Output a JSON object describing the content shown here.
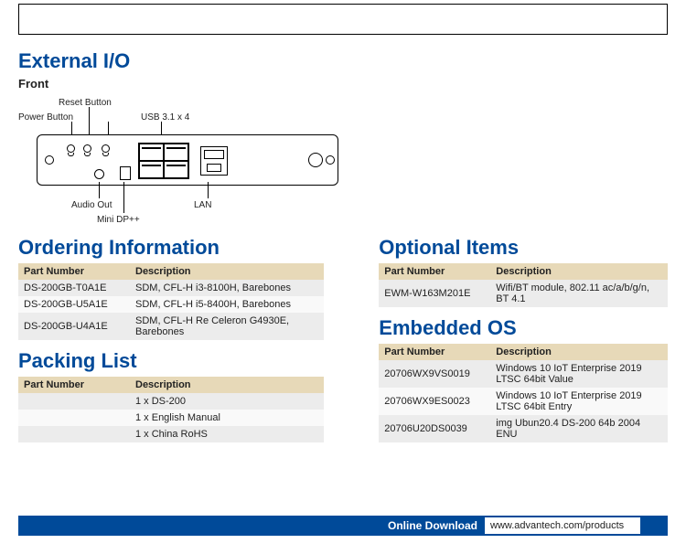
{
  "sections": {
    "external_io": "External I/O",
    "front": "Front",
    "ordering": "Ordering Information",
    "packing": "Packing List",
    "optional": "Optional Items",
    "embedded": "Embedded OS"
  },
  "headers": {
    "part_number": "Part Number",
    "description": "Description"
  },
  "diagram_labels": {
    "power_button": "Power Button",
    "reset_button": "Reset Button",
    "usb": "USB 3.1 x 4",
    "audio_out": "Audio Out",
    "mini_dp": "Mini DP++",
    "lan": "LAN"
  },
  "ordering_rows": [
    {
      "pn": "DS-200GB-T0A1E",
      "desc": "SDM, CFL-H i3-8100H, Barebones"
    },
    {
      "pn": "DS-200GB-U5A1E",
      "desc": "SDM, CFL-H i5-8400H, Barebones"
    },
    {
      "pn": "DS-200GB-U4A1E",
      "desc": "SDM, CFL-H Re Celeron G4930E, Barebones"
    }
  ],
  "packing_rows": [
    {
      "pn": "",
      "desc": "1 x DS-200"
    },
    {
      "pn": "",
      "desc": "1 x English Manual"
    },
    {
      "pn": "",
      "desc": "1 x China RoHS"
    }
  ],
  "optional_rows": [
    {
      "pn": "EWM-W163M201E",
      "desc": "Wifi/BT module, 802.11 ac/a/b/g/n, BT 4.1"
    }
  ],
  "embedded_rows": [
    {
      "pn": "20706WX9VS0019",
      "desc": "Windows 10 IoT Enterprise 2019 LTSC 64bit Value"
    },
    {
      "pn": "20706WX9ES0023",
      "desc": "Windows 10 IoT Enterprise 2019 LTSC 64bit Entry"
    },
    {
      "pn": "20706U20DS0039",
      "desc": "img Ubun20.4 DS-200 64b 2004 ENU"
    }
  ],
  "footer": {
    "label": "Online Download",
    "url": "www.advantech.com/products"
  }
}
